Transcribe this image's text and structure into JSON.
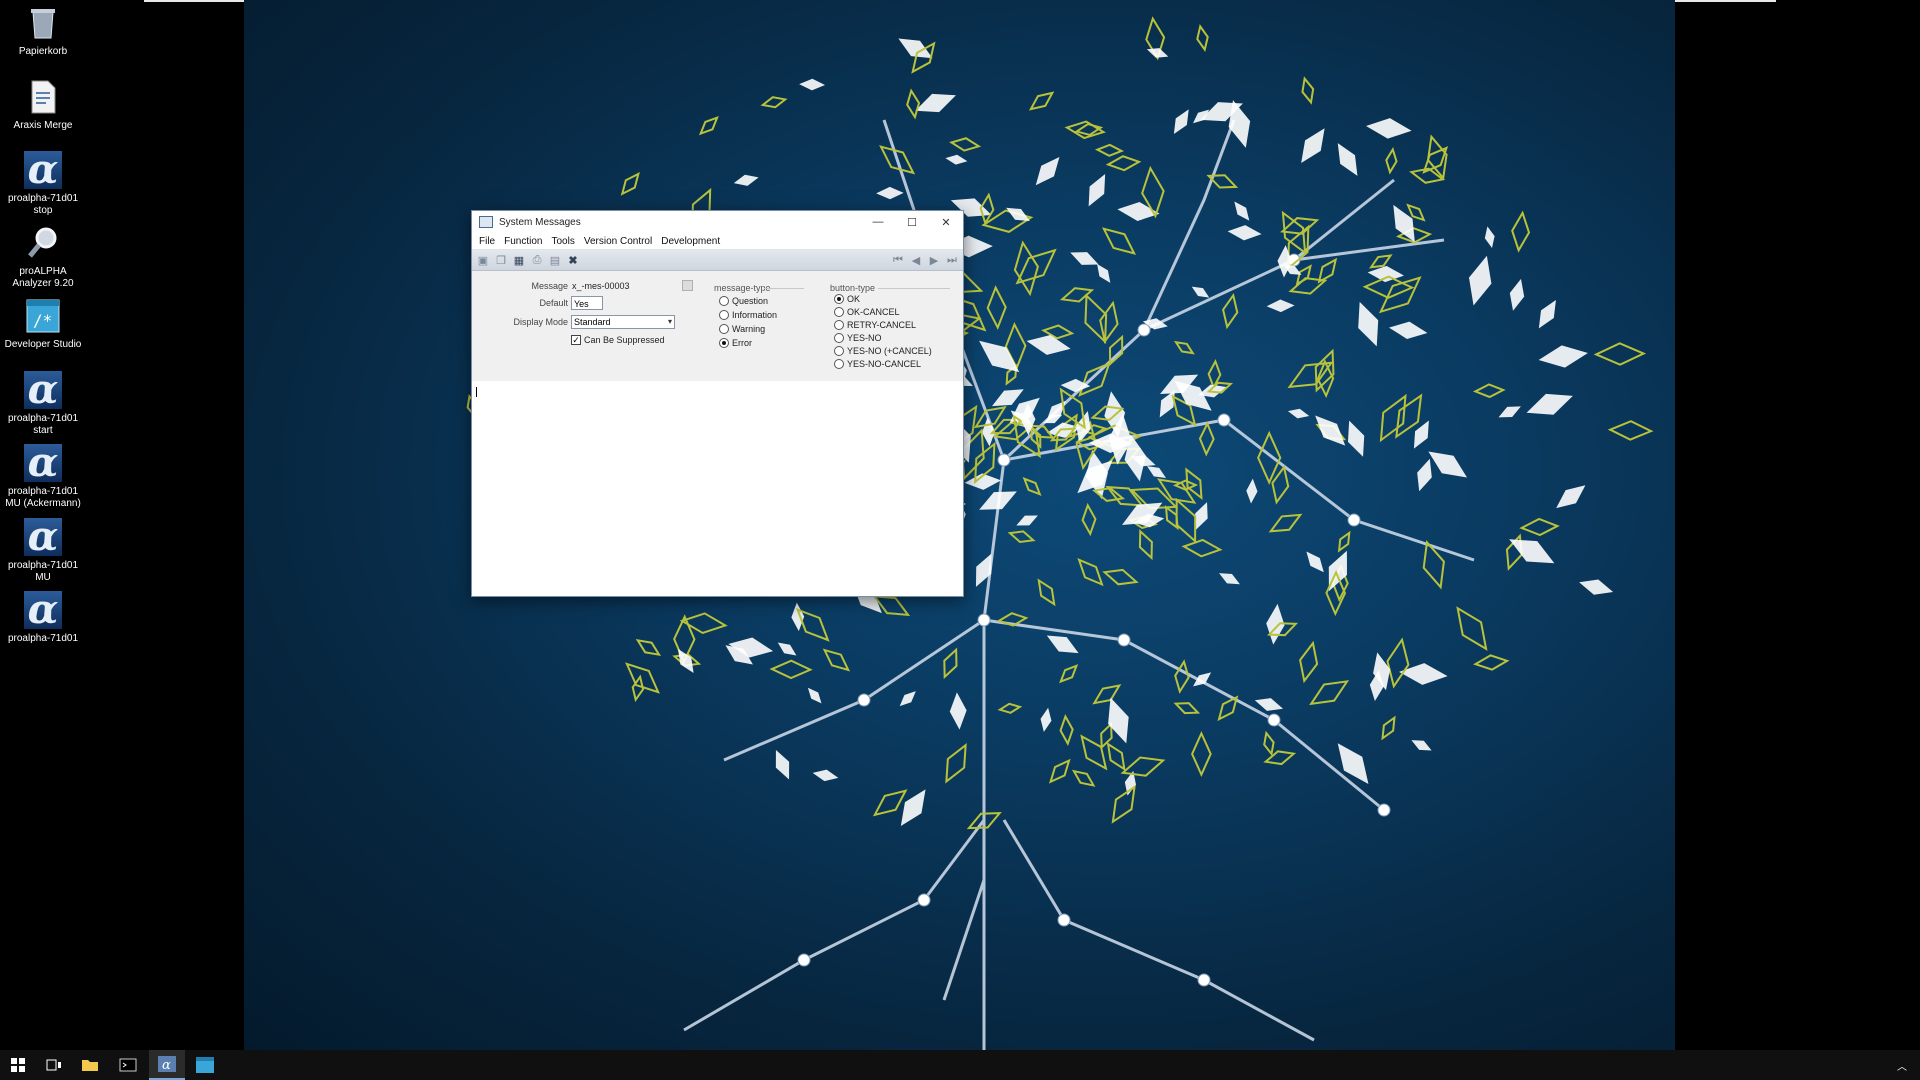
{
  "desktop": {
    "icons": [
      {
        "label": "Papierkorb",
        "icon": "recycle-bin-icon"
      },
      {
        "label": "Araxis Merge",
        "icon": "document-icon"
      },
      {
        "label": "proalpha-71d01 stop",
        "icon": "alpha-icon"
      },
      {
        "label": "proALPHA Analyzer 9.20",
        "icon": "magnifier-icon"
      },
      {
        "label": "Developer Studio",
        "icon": "developer-studio-icon"
      },
      {
        "label": "proalpha-71d01 start",
        "icon": "alpha-icon"
      },
      {
        "label": "proalpha-71d01 MU (Ackermann)",
        "icon": "alpha-icon"
      },
      {
        "label": "proalpha-71d01 MU",
        "icon": "alpha-icon"
      },
      {
        "label": "proalpha-71d01",
        "icon": "alpha-icon"
      }
    ]
  },
  "window": {
    "title": "System Messages",
    "menu": [
      "File",
      "Function",
      "Tools",
      "Version Control",
      "Development"
    ],
    "form": {
      "message_label": "Message",
      "message_value": "x_-mes-00003",
      "default_label": "Default",
      "default_value": "Yes",
      "display_mode_label": "Display Mode",
      "display_mode_value": "Standard",
      "suppress_label": "Can Be Suppressed",
      "suppress_checked": true
    },
    "message_type": {
      "title": "message-type",
      "options": [
        "Question",
        "Information",
        "Warning",
        "Error"
      ],
      "selected": "Error"
    },
    "button_type": {
      "title": "button-type",
      "options": [
        "OK",
        "OK-CANCEL",
        "RETRY-CANCEL",
        "YES-NO",
        "YES-NO (+CANCEL)",
        "YES-NO-CANCEL"
      ],
      "selected": "OK"
    }
  },
  "colors": {
    "wallpaper": "#0a3a60",
    "leaf_green": "#b8c23a",
    "leaf_white": "#ffffff",
    "taskbar": "#101010"
  }
}
